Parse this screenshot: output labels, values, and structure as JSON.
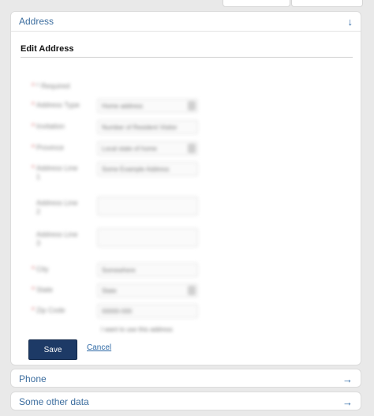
{
  "address_panel": {
    "header": "Address",
    "section_title": "Edit Address",
    "form_rows": [
      {
        "label": "* Required",
        "value": ""
      },
      {
        "label": "Address Type",
        "value": "Home address",
        "type": "select"
      },
      {
        "label": "Invitation",
        "value": "Number of Resident Visitor",
        "type": "text"
      },
      {
        "label": "Province",
        "value": "Local state of home",
        "type": "select"
      },
      {
        "label": "Address Line 1",
        "value": "Some Example Address",
        "type": "text"
      },
      {
        "label": "Address Line 2",
        "value": "",
        "type": "text"
      },
      {
        "label": "Address Line 3",
        "value": "",
        "type": "text"
      },
      {
        "label": "City",
        "value": "Somewhere",
        "type": "text"
      },
      {
        "label": "State",
        "value": "State",
        "type": "select"
      },
      {
        "label": "Zip Code",
        "value": "00000-000",
        "type": "text"
      },
      {
        "label": "",
        "value": "I want to use this address",
        "type": "checkbox"
      }
    ],
    "save_label": "Save",
    "cancel_label": "Cancel"
  },
  "phone_panel": {
    "header": "Phone"
  },
  "other_panel": {
    "header": "Some other data"
  },
  "colors": {
    "accent": "#2f6aa6",
    "save_button": "#1d3a66",
    "required": "#d06060"
  },
  "icons": {
    "address": "arrow-down-icon",
    "phone": "arrow-right-icon",
    "other": "arrow-right-icon"
  }
}
